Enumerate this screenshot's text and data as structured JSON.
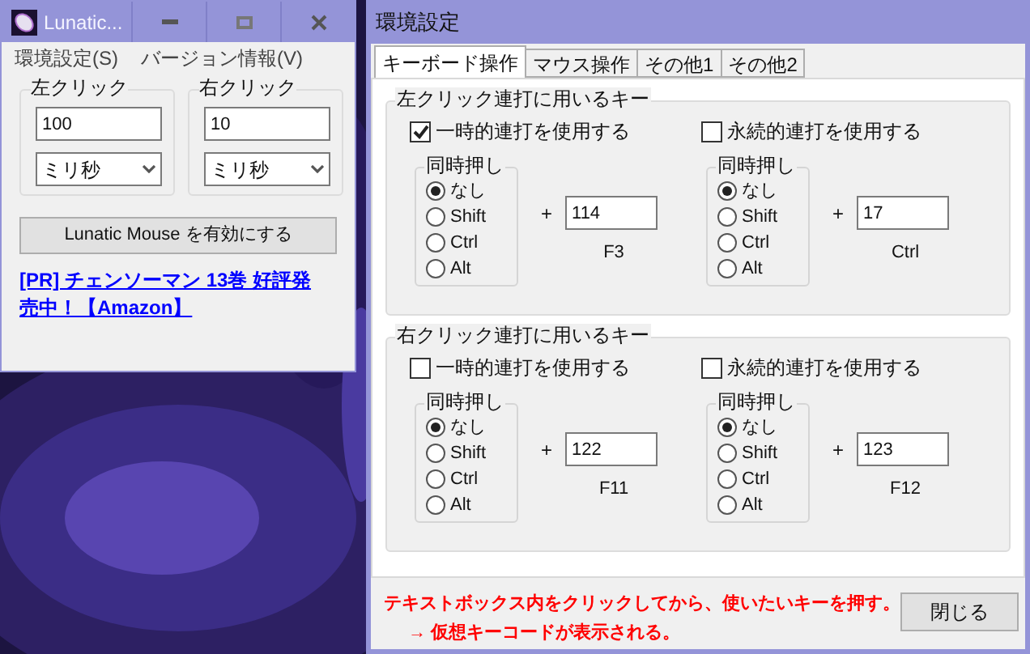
{
  "main_window": {
    "title": "Lunatic...",
    "menu": [
      "環境設定(S)",
      "バージョン情報(V)"
    ],
    "groups": [
      {
        "label": "左クリック",
        "value": "100",
        "unit": "ミリ秒"
      },
      {
        "label": "右クリック",
        "value": "10",
        "unit": "ミリ秒"
      }
    ],
    "toggle_button": "Lunatic Mouse を有効にする",
    "ad_link": "[PR] チェンソーマン 13巻 好評発売中！【Amazon】"
  },
  "settings_window": {
    "title": "環境設定",
    "tabs": [
      {
        "label": "キーボード操作",
        "selected": true
      },
      {
        "label": "マウス操作",
        "selected": false
      },
      {
        "label": "その他1",
        "selected": false
      },
      {
        "label": "その他2",
        "selected": false
      }
    ],
    "sections": [
      {
        "title": "左クリック連打に用いるキー",
        "modes": [
          {
            "label": "一時的連打を使用する",
            "checked": true,
            "modifier_label": "同時押し",
            "modifiers": [
              {
                "label": "なし",
                "selected": true
              },
              {
                "label": "Shift",
                "selected": false
              },
              {
                "label": "Ctrl",
                "selected": false
              },
              {
                "label": "Alt",
                "selected": false
              }
            ],
            "plus": "+",
            "key_code": "114",
            "key_name": "F3"
          },
          {
            "label": "永続的連打を使用する",
            "checked": false,
            "modifier_label": "同時押し",
            "modifiers": [
              {
                "label": "なし",
                "selected": true
              },
              {
                "label": "Shift",
                "selected": false
              },
              {
                "label": "Ctrl",
                "selected": false
              },
              {
                "label": "Alt",
                "selected": false
              }
            ],
            "plus": "+",
            "key_code": "17",
            "key_name": "Ctrl"
          }
        ]
      },
      {
        "title": "右クリック連打に用いるキー",
        "modes": [
          {
            "label": "一時的連打を使用する",
            "checked": false,
            "modifier_label": "同時押し",
            "modifiers": [
              {
                "label": "なし",
                "selected": true
              },
              {
                "label": "Shift",
                "selected": false
              },
              {
                "label": "Ctrl",
                "selected": false
              },
              {
                "label": "Alt",
                "selected": false
              }
            ],
            "plus": "+",
            "key_code": "122",
            "key_name": "F11"
          },
          {
            "label": "永続的連打を使用する",
            "checked": false,
            "modifier_label": "同時押し",
            "modifiers": [
              {
                "label": "なし",
                "selected": true
              },
              {
                "label": "Shift",
                "selected": false
              },
              {
                "label": "Ctrl",
                "selected": false
              },
              {
                "label": "Alt",
                "selected": false
              }
            ],
            "plus": "+",
            "key_code": "123",
            "key_name": "F12"
          }
        ]
      }
    ],
    "hint_lines": [
      "テキストボックス内をクリックしてから、使いたいキーを押す。",
      "→ 仮想キーコードが表示される。"
    ],
    "close_button": "閉じる"
  }
}
